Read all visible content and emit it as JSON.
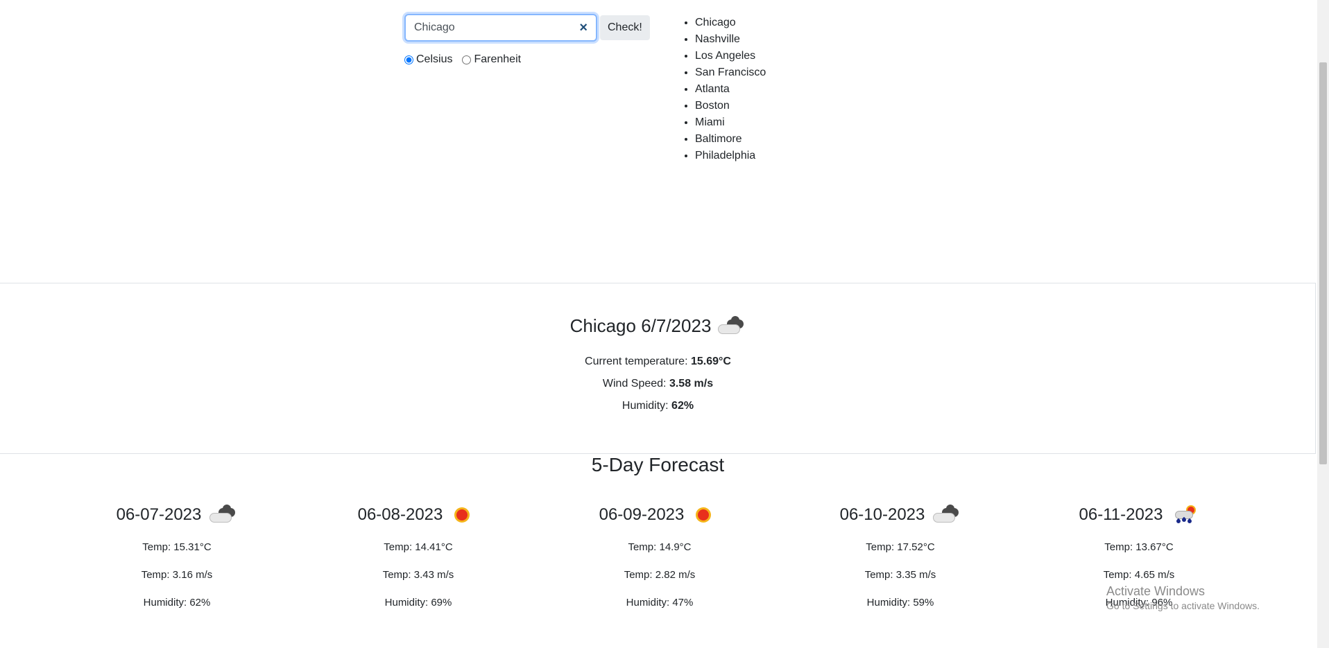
{
  "search": {
    "value": "Chicago",
    "clear_icon": "×",
    "button_label": "Check!"
  },
  "units": {
    "options": [
      {
        "label": "Celsius",
        "checked": true
      },
      {
        "label": "Farenheit",
        "checked": false
      }
    ]
  },
  "cities": [
    "Chicago",
    "Nashville",
    "Los Angeles",
    "San Francisco",
    "Atlanta",
    "Boston",
    "Miami",
    "Baltimore",
    "Philadelphia"
  ],
  "current": {
    "title": "Chicago 6/7/2023",
    "icon": "cloudy-icon",
    "temp_label": "Current temperature: ",
    "temp_value": "15.69°C",
    "wind_label": "Wind Speed: ",
    "wind_value": "3.58 m/s",
    "humidity_label": "Humidity: ",
    "humidity_value": "62%"
  },
  "forecast": {
    "title": "5-Day Forecast",
    "days": [
      {
        "date": "06-07-2023",
        "icon": "cloudy-icon",
        "temp": "Temp: 15.31°C",
        "wind": "Temp: 3.16 m/s",
        "humidity": "Humidity: 62%"
      },
      {
        "date": "06-08-2023",
        "icon": "sun-icon",
        "temp": "Temp: 14.41°C",
        "wind": "Temp: 3.43 m/s",
        "humidity": "Humidity: 69%"
      },
      {
        "date": "06-09-2023",
        "icon": "sun-icon",
        "temp": "Temp: 14.9°C",
        "wind": "Temp: 2.82 m/s",
        "humidity": "Humidity: 47%"
      },
      {
        "date": "06-10-2023",
        "icon": "cloudy-icon",
        "temp": "Temp: 17.52°C",
        "wind": "Temp: 3.35 m/s",
        "humidity": "Humidity: 59%"
      },
      {
        "date": "06-11-2023",
        "icon": "rain-sun-icon",
        "temp": "Temp: 13.67°C",
        "wind": "Temp: 4.65 m/s",
        "humidity": "Humidity: 96%"
      }
    ]
  },
  "watermark": {
    "title": "Activate Windows",
    "subtitle": "Go to Settings to activate Windows."
  }
}
